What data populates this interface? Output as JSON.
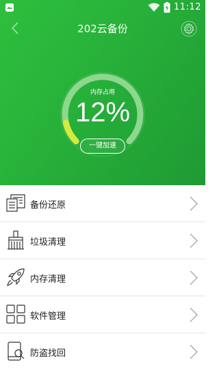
{
  "status_bar": {
    "time": "11:12"
  },
  "header": {
    "title": "202云备份"
  },
  "gauge": {
    "label": "内存占用",
    "value_text": "12%",
    "fill_fraction": 0.12,
    "button_label": "一键加速",
    "colors": {
      "track": "#8ed88e",
      "fill": "#d4ea3e"
    }
  },
  "menu": {
    "items": [
      {
        "label": "备份还原",
        "icon": "document-stack-icon"
      },
      {
        "label": "垃圾清理",
        "icon": "broom-icon"
      },
      {
        "label": "内存清理",
        "icon": "rocket-icon"
      },
      {
        "label": "软件管理",
        "icon": "app-grid-icon"
      },
      {
        "label": "防盗找回",
        "icon": "phone-search-icon"
      }
    ]
  },
  "colors": {
    "header_green": "#27b03a",
    "text": "#222222",
    "divider": "#e4e4e4"
  }
}
